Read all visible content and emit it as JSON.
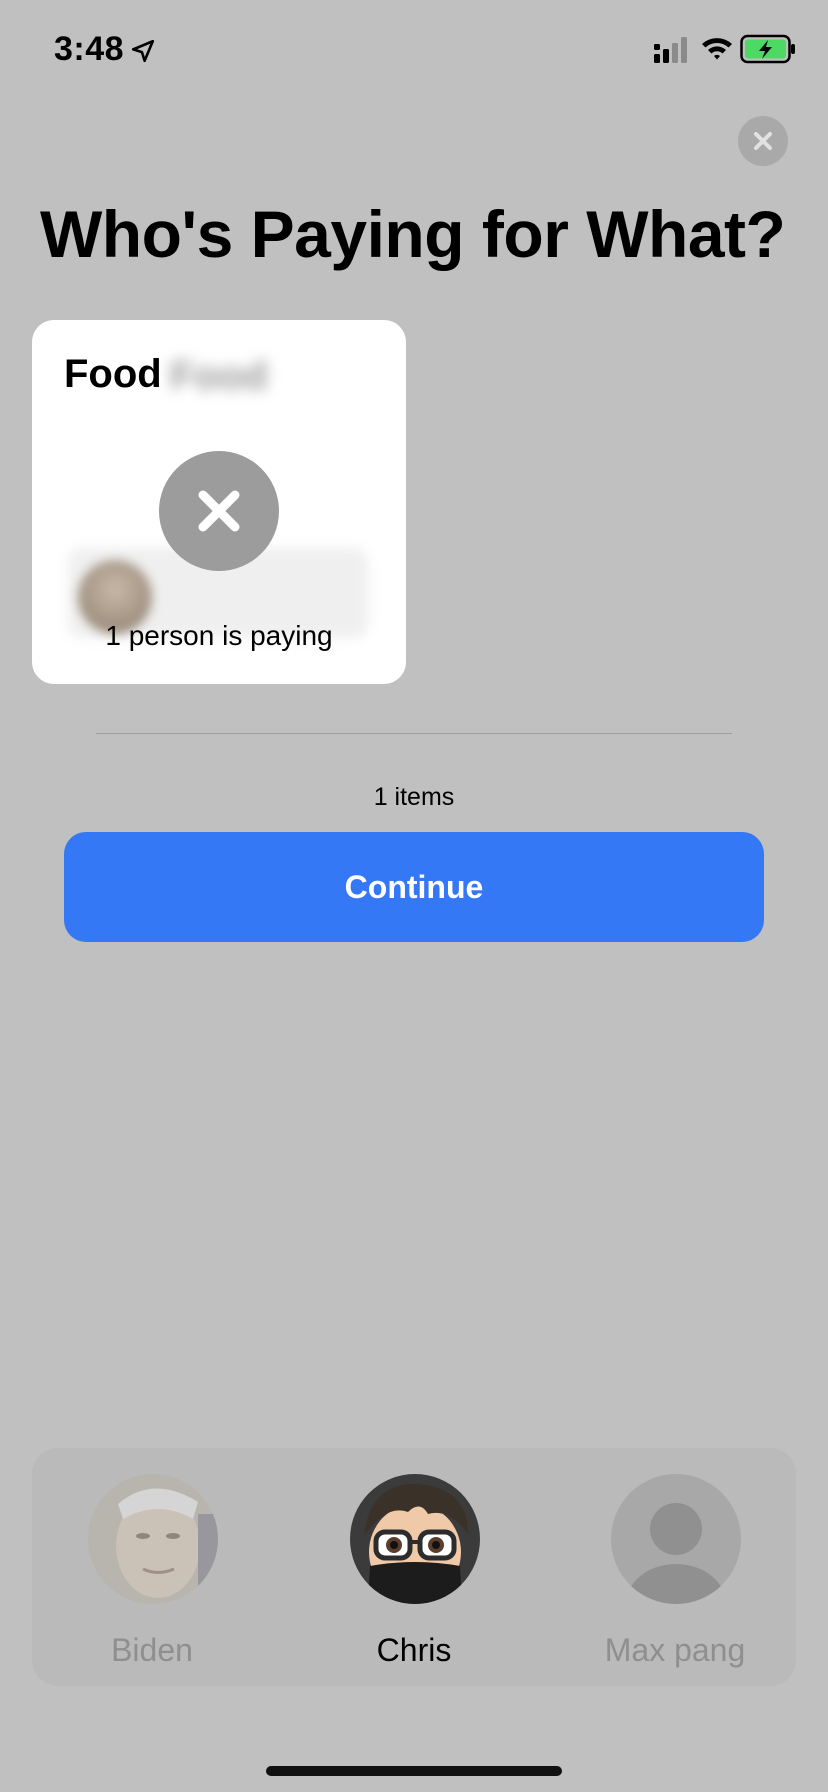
{
  "status_bar": {
    "time": "3:48",
    "icons": [
      "location-arrow-icon",
      "signal-icon",
      "wifi-icon",
      "battery-charging-icon"
    ],
    "battery_color": "#4cd964"
  },
  "header": {
    "title": "Who's Paying for What?",
    "close_icon": "close-icon"
  },
  "item_card": {
    "name": "Food",
    "paying_text": "1 person is paying",
    "remove_icon": "remove-x-icon"
  },
  "summary": {
    "items_count": "1 items",
    "continue_label": "Continue",
    "accent": "#3478f6"
  },
  "people": [
    {
      "name": "Biden",
      "selected": false
    },
    {
      "name": "Chris",
      "selected": true
    },
    {
      "name": "Max pang",
      "selected": false
    }
  ]
}
